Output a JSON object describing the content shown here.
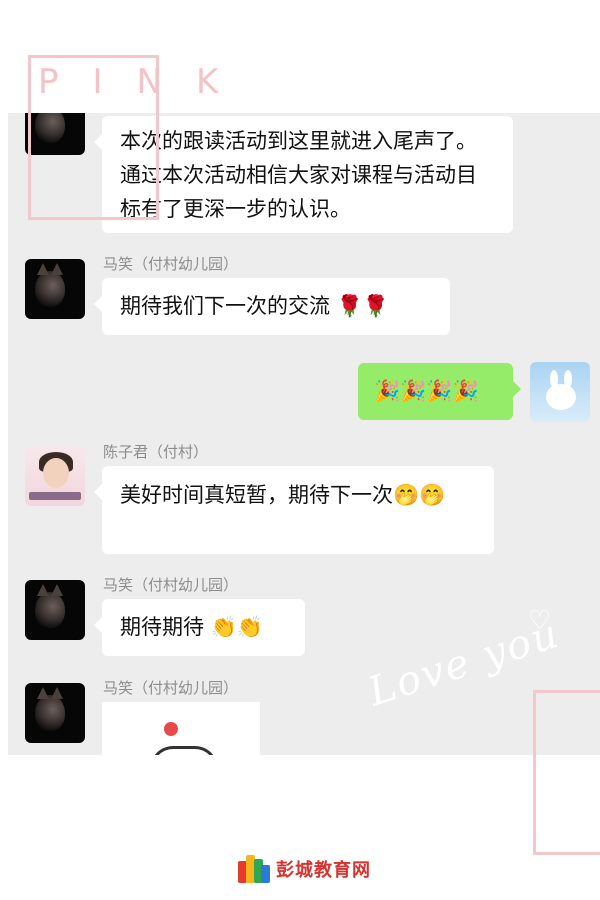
{
  "decor": {
    "pink_word": "PINK",
    "love_text": "Love you",
    "heart": "♡"
  },
  "messages": [
    {
      "kind": "received",
      "avatar": "cat-icon",
      "text": "本次的跟读活动到这里就进入尾声了。通过本次活动相信大家对课程与活动目标有了更深一步的认识。"
    },
    {
      "kind": "received",
      "sender": "马笑（付村幼儿园）",
      "avatar": "cat-icon",
      "text": "期待我们下一次的交流",
      "emojis": "🌹🌹"
    },
    {
      "kind": "sent",
      "avatar": "rabbit-icon",
      "emojis": "🎉🎉🎉🎉"
    },
    {
      "kind": "received",
      "sender": "陈子君（付村）",
      "avatar": "girl-photo",
      "text": "美好时间真短暂，期待下一次",
      "emojis": "🤭🤭"
    },
    {
      "kind": "received",
      "sender": "马笑（付村幼儿园）",
      "avatar": "cat-icon",
      "text": "期待期待",
      "emojis": "👏👏"
    },
    {
      "kind": "received",
      "sender": "马笑（付村幼儿园）",
      "avatar": "cat-icon",
      "sticker": "flower-sticker"
    }
  ],
  "footer": {
    "logo_text": "彭城教育网"
  },
  "colors": {
    "chat_bg": "#ededed",
    "sent_bubble": "#95ec69",
    "received_bubble": "#ffffff",
    "frame_pink": "#f2c8cc",
    "logo_red": "#d8322e"
  }
}
